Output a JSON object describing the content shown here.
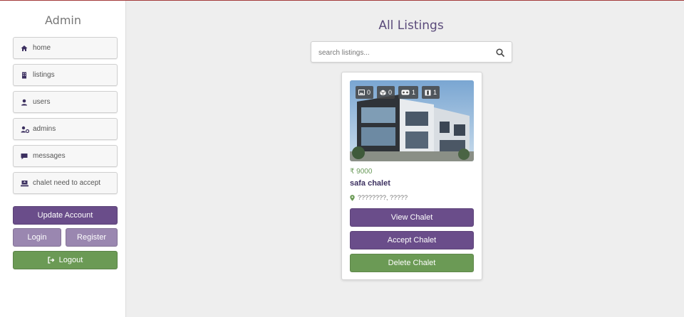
{
  "sidebar": {
    "title": "Admin",
    "nav": [
      {
        "label": "home",
        "icon": "home-icon"
      },
      {
        "label": "listings",
        "icon": "building-icon"
      },
      {
        "label": "users",
        "icon": "user-icon"
      },
      {
        "label": "admins",
        "icon": "user-cog-icon"
      },
      {
        "label": "messages",
        "icon": "message-icon"
      },
      {
        "label": "chalet need to accept",
        "icon": "laptop-house-icon"
      }
    ],
    "update_account": "Update Account",
    "login": "Login",
    "register": "Register",
    "logout": "Logout"
  },
  "main": {
    "title": "All Listings",
    "search": {
      "placeholder": "search listings...",
      "value": ""
    }
  },
  "card": {
    "badges": [
      {
        "icon": "image-icon",
        "count": "0"
      },
      {
        "icon": "cube-icon",
        "count": "0"
      },
      {
        "icon": "vr-icon",
        "count": "1"
      },
      {
        "icon": "film-icon",
        "count": "1"
      }
    ],
    "price": "₹ 9000",
    "name": "safa chalet",
    "location": "????????, ?????",
    "view": "View Chalet",
    "accept": "Accept Chalet",
    "delete": "Delete Chalet"
  },
  "colors": {
    "purple": "#6a4d8a",
    "purple_light": "#9a87b0",
    "green": "#6b9a55",
    "title": "#5a4a7a"
  }
}
